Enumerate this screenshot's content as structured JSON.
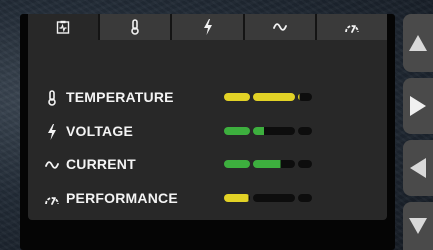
{
  "tabs": [
    {
      "id": "dashboard",
      "icon": "dashboard-icon",
      "active": true
    },
    {
      "id": "temperature",
      "icon": "thermometer-icon",
      "active": false
    },
    {
      "id": "voltage",
      "icon": "lightning-icon",
      "active": false
    },
    {
      "id": "current",
      "icon": "wave-icon",
      "active": false
    },
    {
      "id": "performance",
      "icon": "gauge-icon",
      "active": false
    }
  ],
  "metrics": [
    {
      "label": "TEMPERATURE",
      "icon": "thermometer-icon",
      "level": 0.85,
      "color": "#e2d226"
    },
    {
      "label": "VOLTAGE",
      "icon": "lightning-icon",
      "level": 0.45,
      "color": "#3daf3e"
    },
    {
      "label": "CURRENT",
      "icon": "wave-icon",
      "level": 0.65,
      "color": "#3daf3e"
    },
    {
      "label": "PERFORMANCE",
      "icon": "gauge-icon",
      "level": 0.3,
      "color": "#e2d226"
    }
  ],
  "side_buttons": [
    {
      "icon": "arrow-up-icon"
    },
    {
      "icon": "arrow-right-icon"
    },
    {
      "icon": "arrow-left-icon"
    },
    {
      "icon": "arrow-down-icon"
    }
  ],
  "colors": {
    "panel": "#282828",
    "tab": "#3a3a3a",
    "bar_empty": "#0d0d0d",
    "side_button": "#4a4a4a",
    "side_arrow": "#d9d9d9"
  }
}
